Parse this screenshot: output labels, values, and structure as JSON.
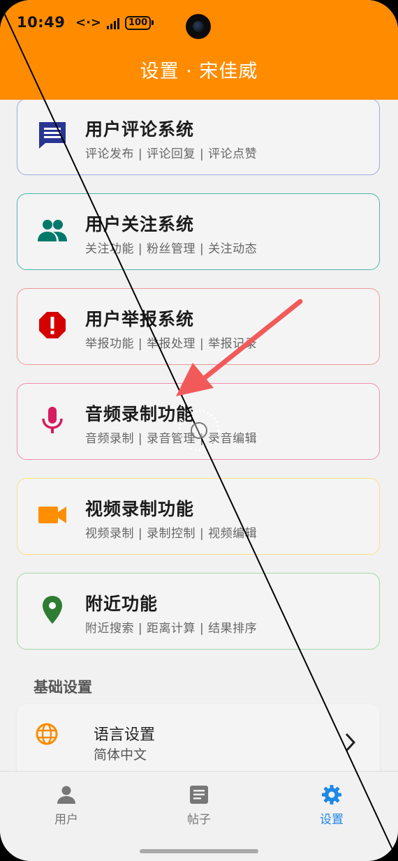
{
  "status_bar": {
    "time": "10:49",
    "data_icon": "<·>",
    "battery": "100"
  },
  "header": {
    "title": "设置 · 宋佳威"
  },
  "features": [
    {
      "title": "用户评论系统",
      "subtitle": "评论发布 | 评论回复 | 评论点赞",
      "icon": "comment-icon",
      "color": "#283593",
      "border": "#9fa8da"
    },
    {
      "title": "用户关注系统",
      "subtitle": "关注功能 | 粉丝管理 | 关注动态",
      "icon": "people-icon",
      "color": "#00796b",
      "border": "#4db6ac"
    },
    {
      "title": "用户举报系统",
      "subtitle": "举报功能 | 举报处理 | 举报记录",
      "icon": "report-icon",
      "color": "#d50000",
      "border": "#ef9a9a"
    },
    {
      "title": "音频录制功能",
      "subtitle": "音频录制 | 录音管理 | 录音编辑",
      "icon": "microphone-icon",
      "color": "#d81b60",
      "border": "#f48fb1"
    },
    {
      "title": "视频录制功能",
      "subtitle": "视频录制 | 录制控制 | 视频编辑",
      "icon": "video-camera-icon",
      "color": "#ff8f00",
      "border": "#ffe082"
    },
    {
      "title": "附近功能",
      "subtitle": "附近搜索 | 距离计算 | 结果排序",
      "icon": "location-pin-icon",
      "color": "#2e7d32",
      "border": "#a5d6a7"
    }
  ],
  "basic_settings": {
    "section_title": "基础设置",
    "language": {
      "title": "语言设置",
      "value": "简体中文",
      "icon": "globe-icon",
      "color": "#fb8c00"
    }
  },
  "bottom_nav": [
    {
      "label": "用户",
      "icon": "person-icon",
      "active": false
    },
    {
      "label": "帖子",
      "icon": "article-icon",
      "active": false
    },
    {
      "label": "设置",
      "icon": "gear-icon",
      "active": true
    }
  ],
  "colors": {
    "header": "#ff8c00",
    "active_nav": "#1e88e5",
    "annotation_arrow": "#f25a5a"
  }
}
